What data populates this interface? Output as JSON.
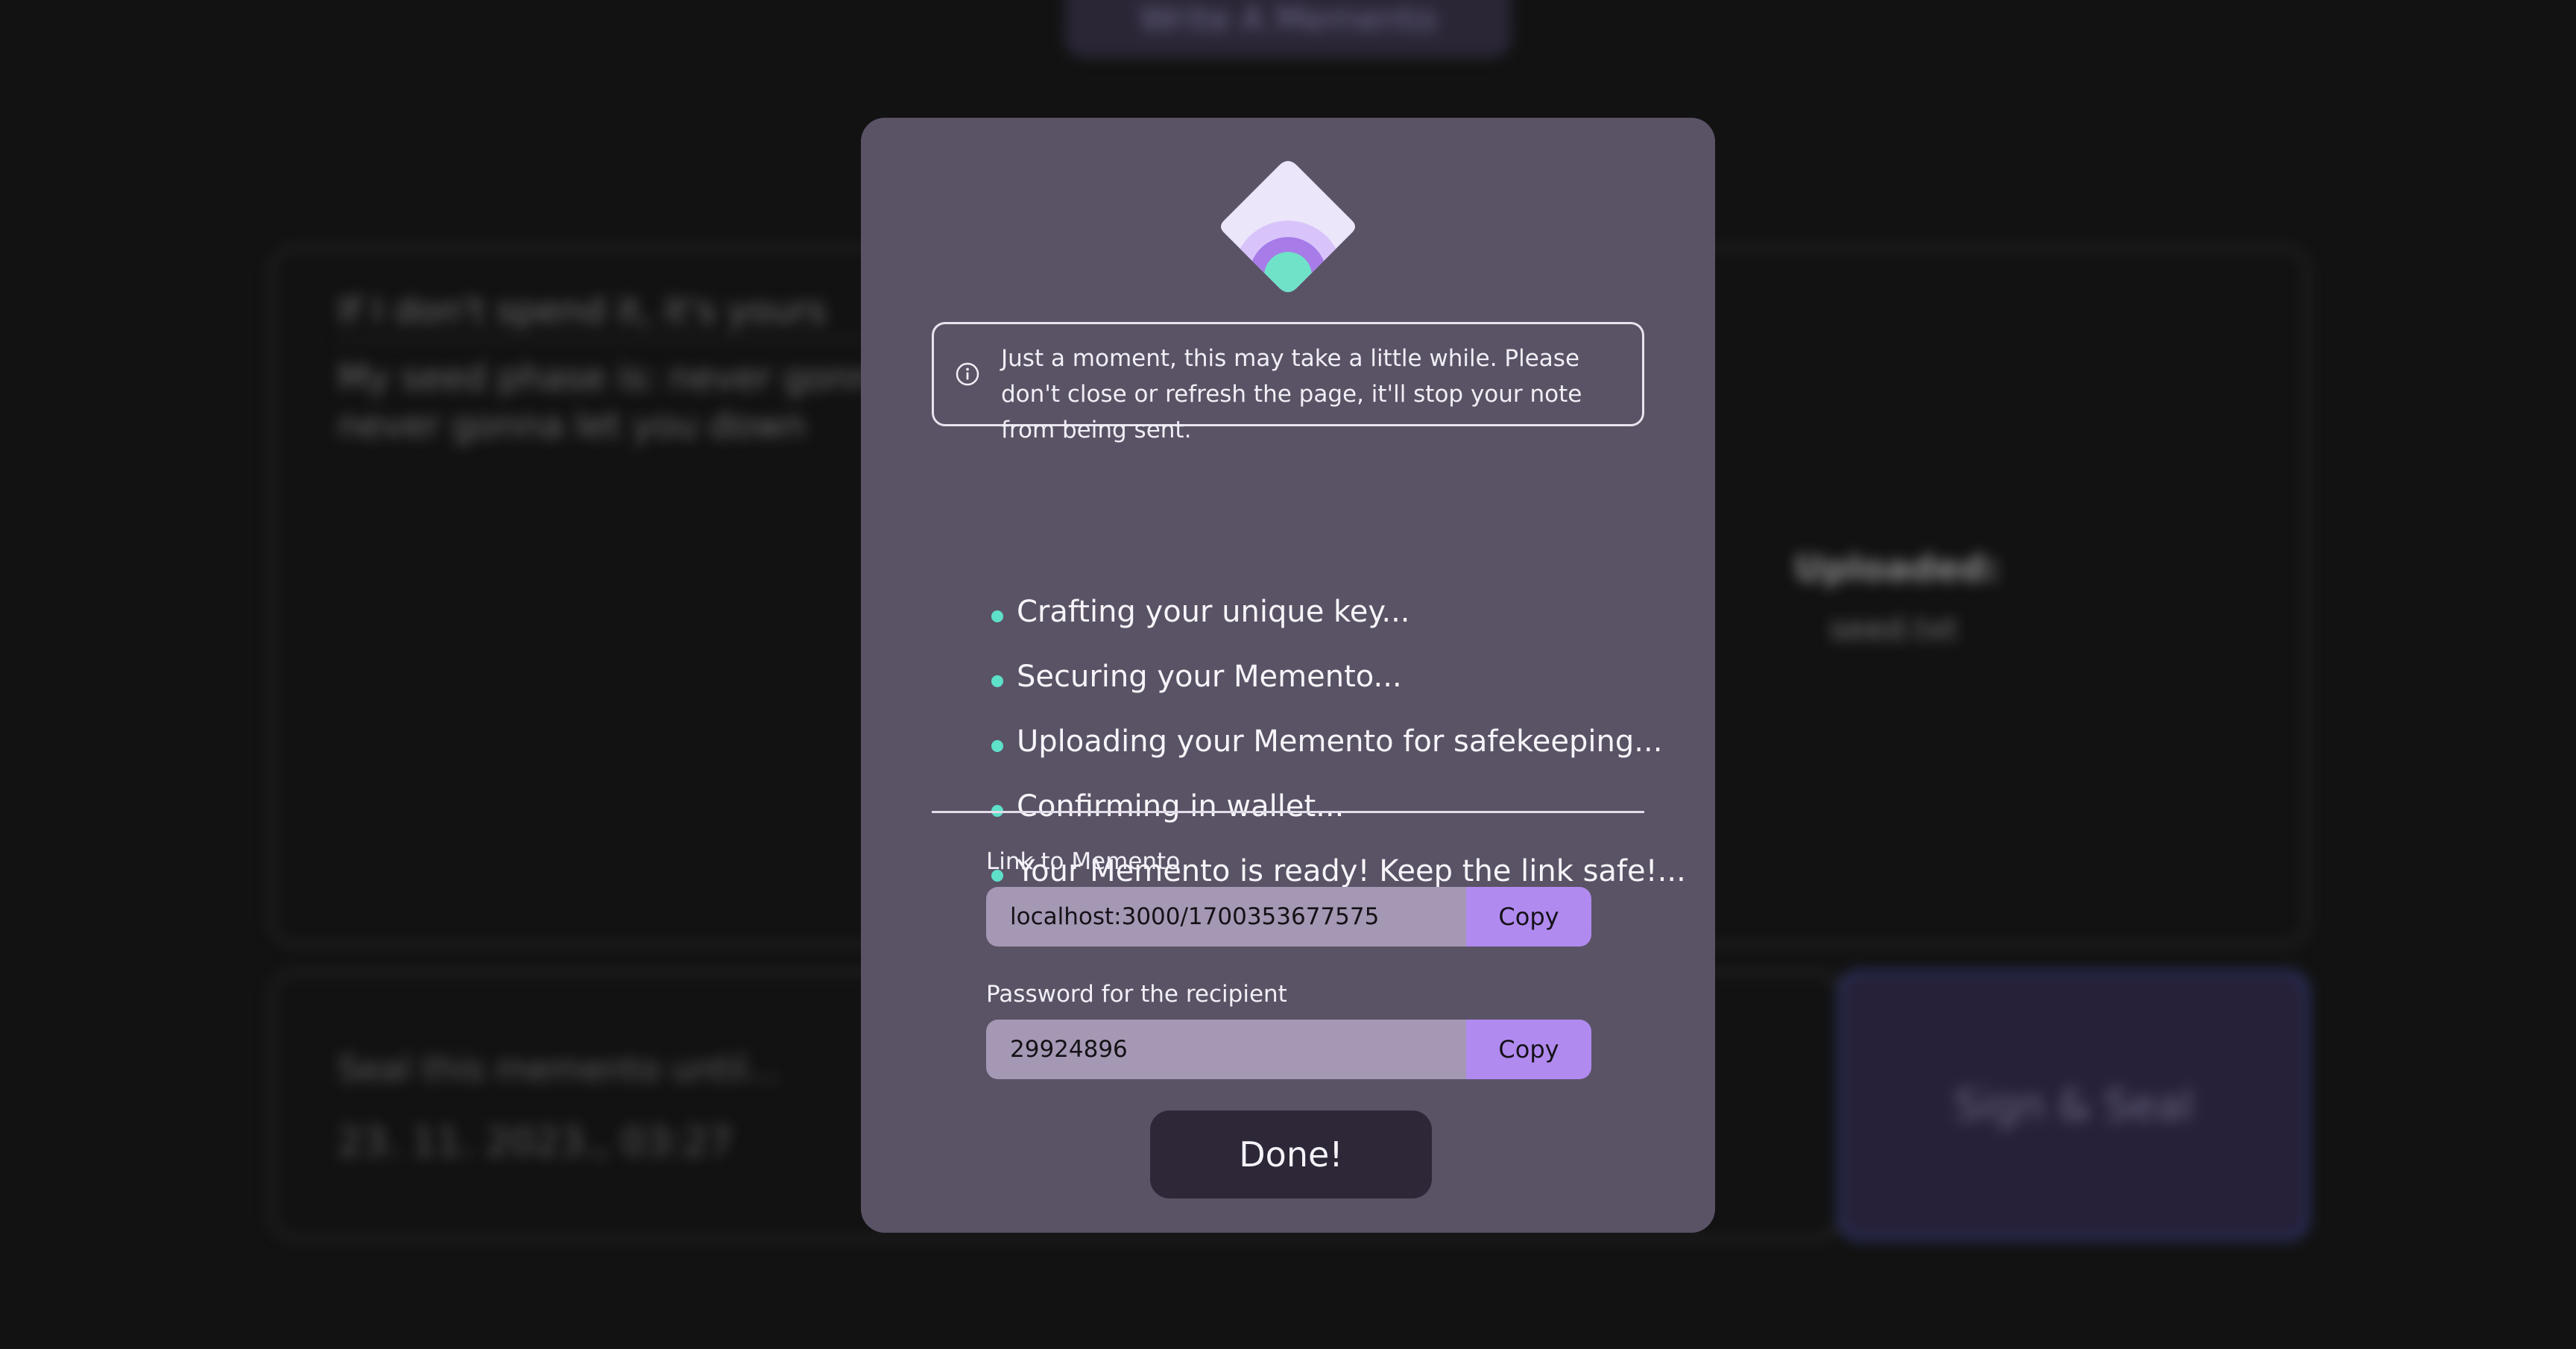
{
  "background": {
    "write_button_label": "Write A Memento",
    "note_title": "If I don't spend it, it's yours",
    "note_body": "My seed phase is: never gonna give you up, never gonna let you down",
    "uploaded_label": "Uploaded:",
    "uploaded_file": "seed.txt",
    "seal_label": "Seal this memento until...",
    "seal_date": "23. 11. 2023., 03:27",
    "sign_button_label": "Sign & Seal"
  },
  "modal": {
    "logo_icon": "memento-logo-icon",
    "info_icon": "info-icon",
    "info_text": "Just a moment, this may take a little while. Please don't close or refresh the page, it'll stop your note from being sent.",
    "steps": [
      "Crafting your unique key...",
      "Securing your Memento...",
      "Uploading your Memento for safekeeping...",
      "Confirming in wallet...",
      "Your Memento is ready! Keep the link safe!..."
    ],
    "link_label": "Link to Memento",
    "link_value": "localhost:3000/1700353677575",
    "password_label": "Password for the recipient",
    "password_value": "29924896",
    "copy_label": "Copy",
    "done_label": "Done!"
  },
  "colors": {
    "modal_bg": "#5a5366",
    "accent_purple": "#b18af0",
    "step_dot": "#5ee0c9",
    "done_button": "#2d2738"
  }
}
